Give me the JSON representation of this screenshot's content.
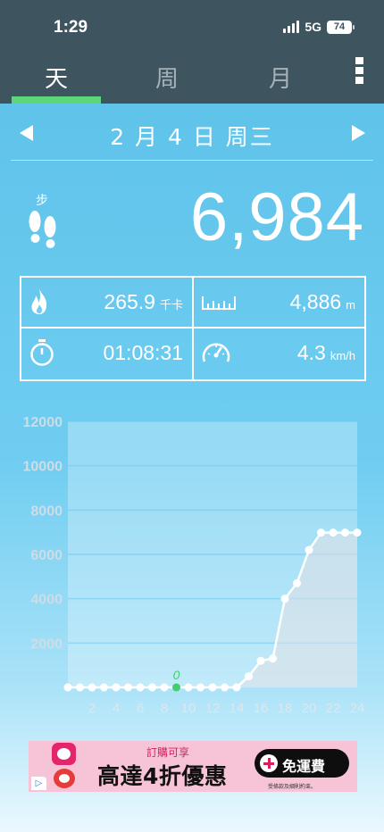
{
  "status_bar": {
    "time": "1:29",
    "network": "5G",
    "battery": "74"
  },
  "tabs": [
    {
      "label": "天",
      "selected": true
    },
    {
      "label": "周",
      "selected": false
    },
    {
      "label": "月",
      "selected": false
    }
  ],
  "colors": {
    "accent": "#5cd777",
    "header": "#3e5560",
    "background": "#5bc0e8"
  },
  "date": {
    "title": "2 月 4 日 周三"
  },
  "steps": {
    "label": "步",
    "count": "6,984"
  },
  "stats": {
    "calories": {
      "value": "265.9",
      "unit": "千卡",
      "icon": "flame-icon"
    },
    "distance": {
      "value": "4,886",
      "unit": "m",
      "icon": "ruler-icon"
    },
    "duration": {
      "value": "01:08:31",
      "icon": "stopwatch-icon"
    },
    "speed": {
      "value": "4.3",
      "unit": "km/h",
      "icon": "speedometer-icon"
    }
  },
  "chart_data": {
    "type": "line",
    "x": [
      0,
      1,
      2,
      3,
      4,
      5,
      6,
      7,
      8,
      9,
      10,
      11,
      12,
      13,
      14,
      15,
      16,
      17,
      18,
      19,
      20,
      21,
      22,
      23,
      24
    ],
    "values": [
      0,
      0,
      0,
      0,
      0,
      0,
      0,
      0,
      0,
      0,
      0,
      0,
      0,
      0,
      0,
      500,
      1200,
      1300,
      4000,
      4700,
      6200,
      6984,
      6984,
      6984,
      6984
    ],
    "x_tick_labels": [
      "2",
      "4",
      "6",
      "8",
      "10",
      "12",
      "14",
      "16",
      "18",
      "20",
      "22",
      "24"
    ],
    "y_tick_labels": [
      "2000",
      "4000",
      "6000",
      "8000",
      "10000",
      "12000"
    ],
    "ylim": [
      0,
      12000
    ],
    "xlim": [
      0,
      24
    ],
    "highlight": {
      "x": 9,
      "label": "0"
    },
    "grid": true
  },
  "ad": {
    "small_text": "訂購可享",
    "headline": "高達4折優惠",
    "button": "免運費",
    "fine_print": "受條款及細則約束。",
    "choices_icon": "ad-choices-icon"
  }
}
